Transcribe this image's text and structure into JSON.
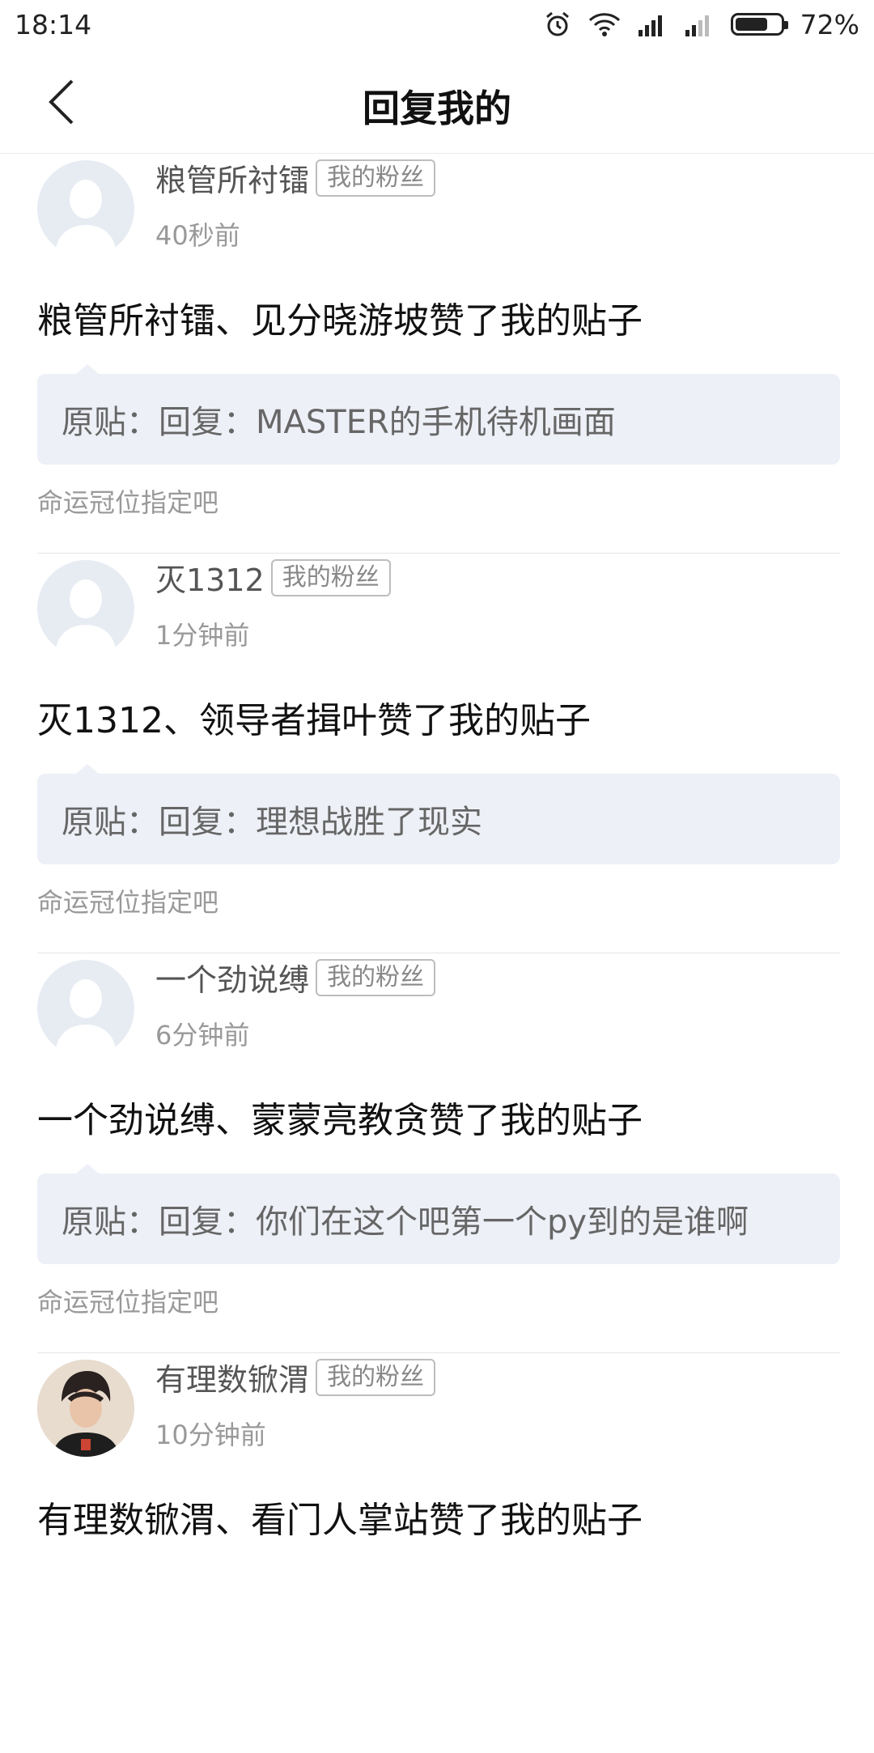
{
  "status_bar": {
    "time": "18:14",
    "battery": "72%"
  },
  "header": {
    "title": "回复我的"
  },
  "fan_badge_label": "我的粉丝",
  "items": [
    {
      "username": "粮管所衬镭",
      "time": "40秒前",
      "text": "粮管所衬镭、见分晓游坡赞了我的贴子",
      "quote": "原贴：回复：MASTER的手机待机画面",
      "forum": "命运冠位指定吧",
      "avatar": "default-avatar-icon"
    },
    {
      "username": "灭1312",
      "time": "1分钟前",
      "text": "灭1312、领导者揖叶赞了我的贴子",
      "quote": "原贴：回复：理想战胜了现实",
      "forum": "命运冠位指定吧",
      "avatar": "default-avatar-icon"
    },
    {
      "username": "一个劲说缚",
      "time": "6分钟前",
      "text": "一个劲说缚、蒙蒙亮教贪赞了我的贴子",
      "quote": "原贴：回复：你们在这个吧第一个py到的是谁啊",
      "forum": "命运冠位指定吧",
      "avatar": "default-avatar-icon"
    },
    {
      "username": "有理数锨渭",
      "time": "10分钟前",
      "text": "有理数锨渭、看门人掌站赞了我的贴子",
      "quote": "",
      "forum": "",
      "avatar": "photo-avatar"
    }
  ]
}
